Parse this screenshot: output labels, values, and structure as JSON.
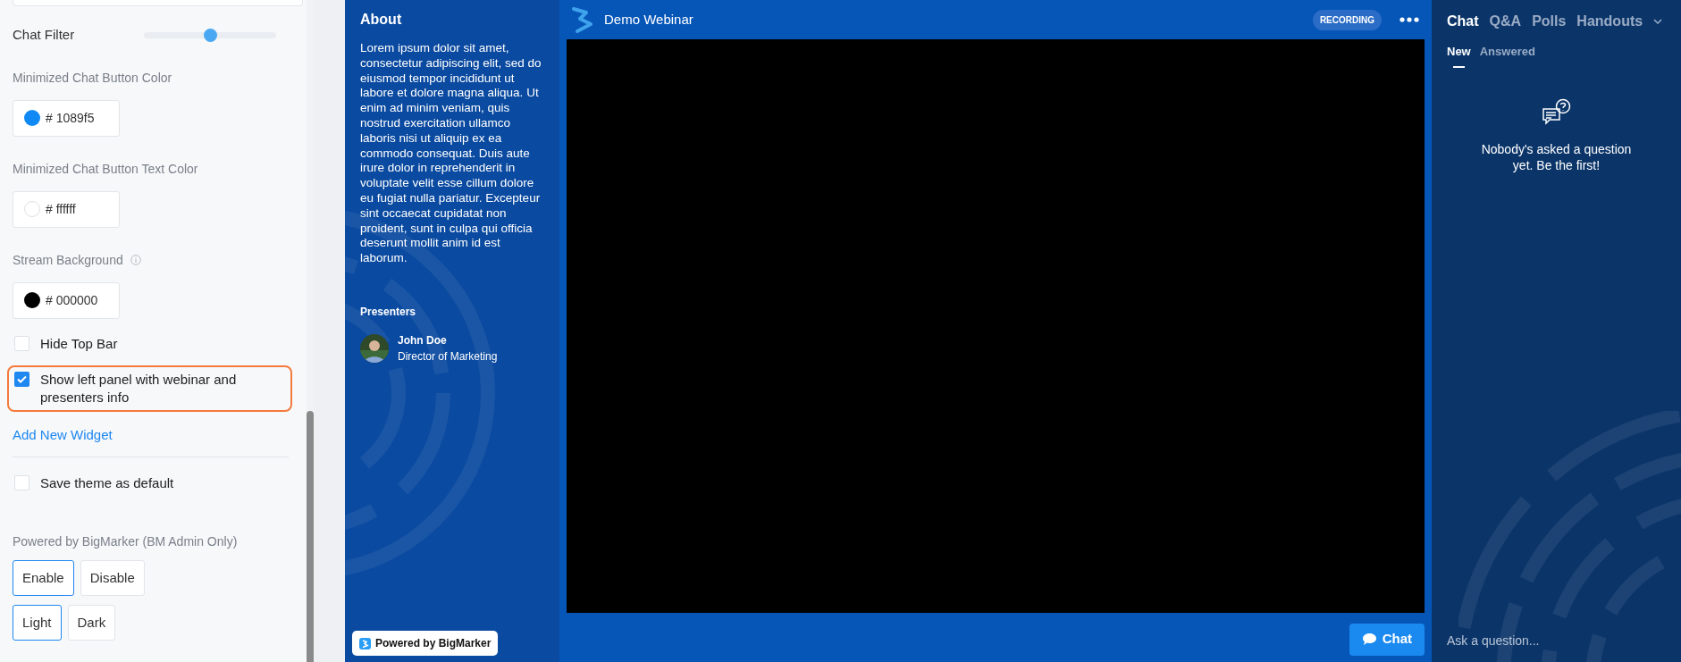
{
  "settings": {
    "chat_filter": {
      "label": "Chat Filter",
      "level": 0.5
    },
    "color_fields": [
      {
        "label": "Minimized Chat Button Color",
        "value": "# 1089f5",
        "color": "#1089f5",
        "info": false
      },
      {
        "label": "Minimized Chat Button Text Color",
        "value": "# ffffff",
        "color": "#ffffff",
        "info": false
      },
      {
        "label": "Stream Background",
        "value": "# 000000",
        "color": "#000000",
        "info": true
      }
    ],
    "checkboxes": [
      {
        "label": "Hide Top Bar",
        "checked": false,
        "highlighted": false
      },
      {
        "label": "Show left panel with webinar and presenters info",
        "checked": true,
        "highlighted": true
      }
    ],
    "add_widget_link": "Add New Widget",
    "save_default": {
      "label": "Save theme as default",
      "checked": false
    },
    "powered_by": {
      "label": "Powered by BigMarker (BM Admin Only)",
      "groups": [
        {
          "options": [
            {
              "label": "Enable",
              "selected": true
            },
            {
              "label": "Disable",
              "selected": false
            }
          ]
        },
        {
          "options": [
            {
              "label": "Light",
              "selected": true
            },
            {
              "label": "Dark",
              "selected": false
            }
          ]
        }
      ]
    }
  },
  "about_panel": {
    "title": "About",
    "text": "Lorem ipsum dolor sit amet, consectetur adipiscing elit, sed do eiusmod tempor incididunt ut labore et dolore magna aliqua. Ut enim ad minim veniam, quis nostrud exercitation ullamco laboris nisi ut aliquip ex ea commodo consequat. Duis aute irure dolor in reprehenderit in voluptate velit esse cillum dolore eu fugiat nulla pariatur. Excepteur sint occaecat cupidatat non proident, sunt in culpa qui officia deserunt mollit anim id est laborum.",
    "presenters_title": "Presenters",
    "presenters": [
      {
        "name": "John Doe",
        "role": "Director of Marketing"
      }
    ],
    "powered_badge": "Powered by BigMarker"
  },
  "stage": {
    "title": "Demo Webinar",
    "recording_badge": "RECORDING",
    "chat_button": "Chat"
  },
  "side_panel": {
    "tabs": [
      {
        "label": "Chat",
        "selected": true
      },
      {
        "label": "Q&A",
        "selected": false
      },
      {
        "label": "Polls",
        "selected": false
      },
      {
        "label": "Handouts",
        "selected": false
      }
    ],
    "subtabs": [
      {
        "label": "New",
        "selected": true
      },
      {
        "label": "Answered",
        "selected": false
      }
    ],
    "empty_message": "Nobody's asked a question yet. Be the first!",
    "input_placeholder": "Ask a question..."
  }
}
